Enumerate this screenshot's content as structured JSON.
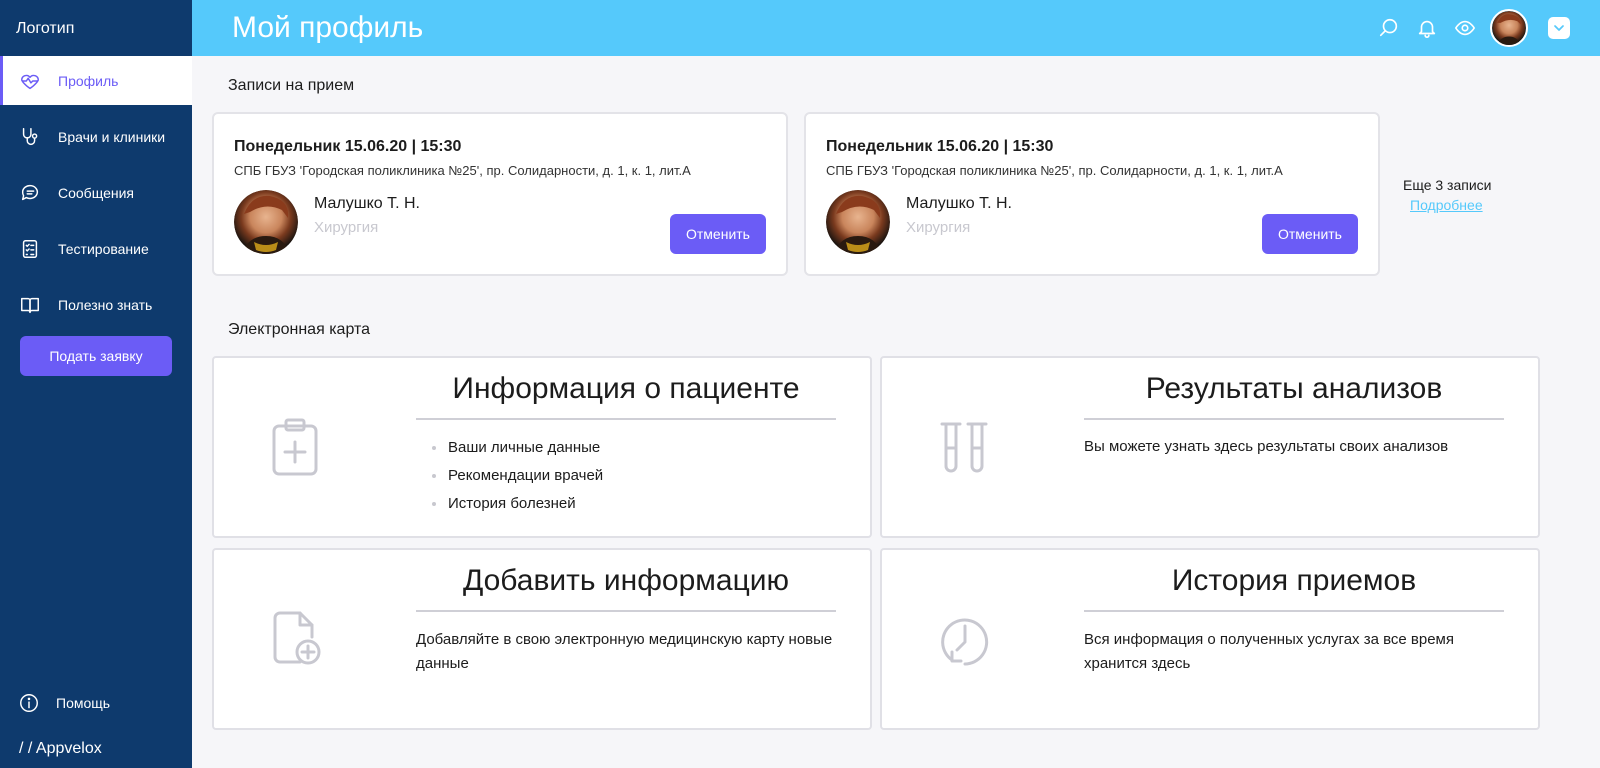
{
  "sidebar": {
    "logo": "Логотип",
    "items": [
      {
        "label": "Профиль",
        "icon": "heart-pulse-icon"
      },
      {
        "label": "Врачи и клиники",
        "icon": "stethoscope-icon"
      },
      {
        "label": "Сообщения",
        "icon": "chat-icon"
      },
      {
        "label": "Тестирование",
        "icon": "checklist-icon"
      },
      {
        "label": "Полезно знать",
        "icon": "book-icon"
      }
    ],
    "submit_label": "Подать заявку",
    "help_label": "Помощь",
    "brand": "/ / Appvelox"
  },
  "header": {
    "title": "Мой профиль",
    "icons": [
      "search-icon",
      "bell-icon",
      "eye-icon",
      "user-avatar",
      "chevron-down-icon"
    ]
  },
  "appointments": {
    "section_title": "Записи на прием",
    "cards": [
      {
        "datetime": "Понедельник 15.06.20 | 15:30",
        "address": "СПБ ГБУЗ 'Городская поликлиника №25', пр. Солидарности, д. 1, к. 1, лит.А",
        "doctor": "Малушко Т. Н.",
        "specialty": "Хирургия",
        "cancel_label": "Отменить"
      },
      {
        "datetime": "Понедельник 15.06.20 | 15:30",
        "address": "СПБ ГБУЗ 'Городская поликлиника №25', пр. Солидарности, д. 1, к. 1, лит.А",
        "doctor": "Малушко Т. Н.",
        "specialty": "Хирургия",
        "cancel_label": "Отменить"
      }
    ],
    "more_count": "Еще 3 записи",
    "more_link": "Подробнее"
  },
  "ecard": {
    "section_title": "Электронная карта",
    "cards": [
      {
        "title": "Информация о пациенте",
        "icon": "clipboard-plus-icon",
        "items": [
          "Ваши личные данные",
          "Рекомендации врачей",
          "История болезней"
        ]
      },
      {
        "title": "Результаты анализов",
        "icon": "test-tubes-icon",
        "text": "Вы можете узнать здесь результаты своих анализов"
      },
      {
        "title": "Добавить информацию",
        "icon": "file-add-icon",
        "text": "Добавляйте в свою электронную медицинскую карту новые данные"
      },
      {
        "title": "История приемов",
        "icon": "clock-history-icon",
        "text": "Вся информация о полученных услугах за все время хранится здесь"
      }
    ]
  },
  "colors": {
    "sidebar_bg": "#0e3a6d",
    "header_bg": "#55c9fb",
    "accent": "#6b5cf6",
    "link": "#55c9fb"
  }
}
